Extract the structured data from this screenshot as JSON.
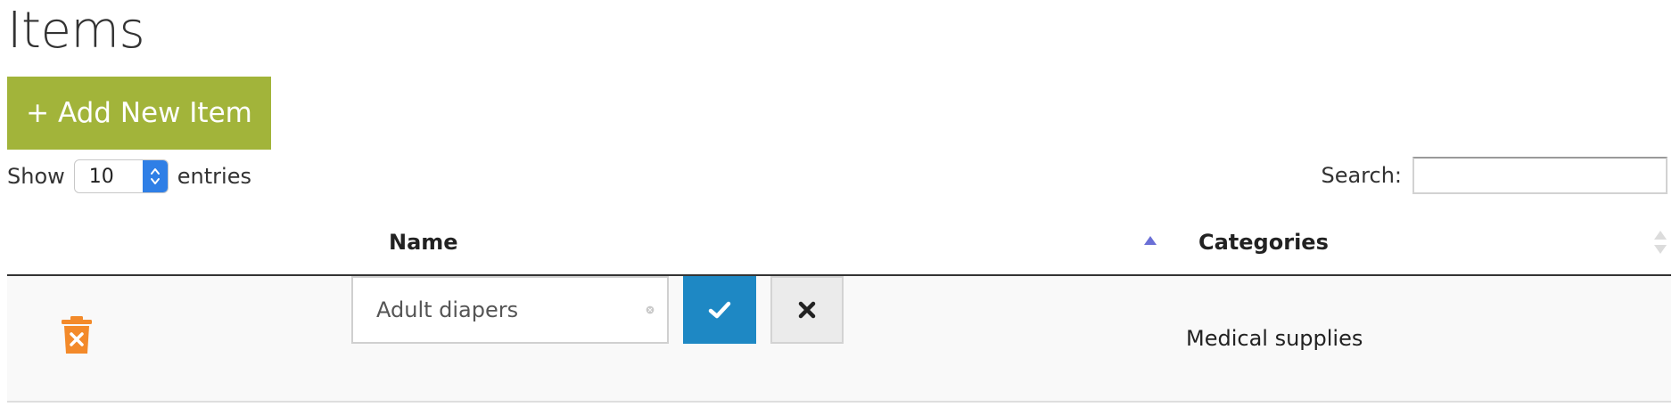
{
  "page": {
    "title": "Items"
  },
  "toolbar": {
    "add_label": "+ Add New Item",
    "add_color": "#a2b43a"
  },
  "length": {
    "show_label": "Show",
    "selected": "10",
    "entries_label": "entries"
  },
  "search": {
    "label": "Search:",
    "value": "",
    "placeholder": ""
  },
  "table": {
    "columns": [
      {
        "label": "",
        "sortable": false
      },
      {
        "label": "Name",
        "sort": "ascending"
      },
      {
        "label": "Categories",
        "sort": "none"
      }
    ],
    "rows": [
      {
        "name": "Adult diapers",
        "category": "Medical supplies",
        "editing": true
      }
    ]
  },
  "icons": {
    "delete": "trash-icon",
    "clear": "clear-circle-icon",
    "confirm": "checkmark-icon",
    "cancel": "close-icon",
    "sort_asc": "sort-ascending-icon",
    "sort_both": "sort-both-icon",
    "select_spin": "select-arrows-icon"
  },
  "colors": {
    "delete_icon": "#f38a2a",
    "confirm_button": "#1e88c4",
    "select_spin": "#2f7fe6",
    "sort_active": "#6a6fd6"
  }
}
